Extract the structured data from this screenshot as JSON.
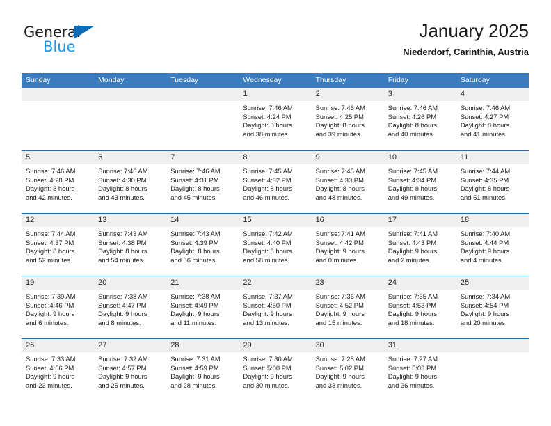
{
  "brand": {
    "name_part1": "General",
    "name_part2": "Blue",
    "triangle_icon": "triangle-icon",
    "accent_color": "#0e6cb5",
    "accent_color_light": "#2196e8"
  },
  "header": {
    "title": "January 2025",
    "subtitle": "Niederdorf, Carinthia, Austria"
  },
  "calendar": {
    "header_bg": "#3a7cbe",
    "row_divider_color": "#2b6cab",
    "date_band_bg": "#efefef",
    "weekdays": [
      "Sunday",
      "Monday",
      "Tuesday",
      "Wednesday",
      "Thursday",
      "Friday",
      "Saturday"
    ],
    "weeks": [
      [
        {
          "day": "",
          "empty": true,
          "lines": []
        },
        {
          "day": "",
          "empty": true,
          "lines": []
        },
        {
          "day": "",
          "empty": true,
          "lines": []
        },
        {
          "day": "1",
          "empty": false,
          "lines": [
            "Sunrise: 7:46 AM",
            "Sunset: 4:24 PM",
            "Daylight: 8 hours",
            "and 38 minutes."
          ]
        },
        {
          "day": "2",
          "empty": false,
          "lines": [
            "Sunrise: 7:46 AM",
            "Sunset: 4:25 PM",
            "Daylight: 8 hours",
            "and 39 minutes."
          ]
        },
        {
          "day": "3",
          "empty": false,
          "lines": [
            "Sunrise: 7:46 AM",
            "Sunset: 4:26 PM",
            "Daylight: 8 hours",
            "and 40 minutes."
          ]
        },
        {
          "day": "4",
          "empty": false,
          "lines": [
            "Sunrise: 7:46 AM",
            "Sunset: 4:27 PM",
            "Daylight: 8 hours",
            "and 41 minutes."
          ]
        }
      ],
      [
        {
          "day": "5",
          "empty": false,
          "lines": [
            "Sunrise: 7:46 AM",
            "Sunset: 4:28 PM",
            "Daylight: 8 hours",
            "and 42 minutes."
          ]
        },
        {
          "day": "6",
          "empty": false,
          "lines": [
            "Sunrise: 7:46 AM",
            "Sunset: 4:30 PM",
            "Daylight: 8 hours",
            "and 43 minutes."
          ]
        },
        {
          "day": "7",
          "empty": false,
          "lines": [
            "Sunrise: 7:46 AM",
            "Sunset: 4:31 PM",
            "Daylight: 8 hours",
            "and 45 minutes."
          ]
        },
        {
          "day": "8",
          "empty": false,
          "lines": [
            "Sunrise: 7:45 AM",
            "Sunset: 4:32 PM",
            "Daylight: 8 hours",
            "and 46 minutes."
          ]
        },
        {
          "day": "9",
          "empty": false,
          "lines": [
            "Sunrise: 7:45 AM",
            "Sunset: 4:33 PM",
            "Daylight: 8 hours",
            "and 48 minutes."
          ]
        },
        {
          "day": "10",
          "empty": false,
          "lines": [
            "Sunrise: 7:45 AM",
            "Sunset: 4:34 PM",
            "Daylight: 8 hours",
            "and 49 minutes."
          ]
        },
        {
          "day": "11",
          "empty": false,
          "lines": [
            "Sunrise: 7:44 AM",
            "Sunset: 4:35 PM",
            "Daylight: 8 hours",
            "and 51 minutes."
          ]
        }
      ],
      [
        {
          "day": "12",
          "empty": false,
          "lines": [
            "Sunrise: 7:44 AM",
            "Sunset: 4:37 PM",
            "Daylight: 8 hours",
            "and 52 minutes."
          ]
        },
        {
          "day": "13",
          "empty": false,
          "lines": [
            "Sunrise: 7:43 AM",
            "Sunset: 4:38 PM",
            "Daylight: 8 hours",
            "and 54 minutes."
          ]
        },
        {
          "day": "14",
          "empty": false,
          "lines": [
            "Sunrise: 7:43 AM",
            "Sunset: 4:39 PM",
            "Daylight: 8 hours",
            "and 56 minutes."
          ]
        },
        {
          "day": "15",
          "empty": false,
          "lines": [
            "Sunrise: 7:42 AM",
            "Sunset: 4:40 PM",
            "Daylight: 8 hours",
            "and 58 minutes."
          ]
        },
        {
          "day": "16",
          "empty": false,
          "lines": [
            "Sunrise: 7:41 AM",
            "Sunset: 4:42 PM",
            "Daylight: 9 hours",
            "and 0 minutes."
          ]
        },
        {
          "day": "17",
          "empty": false,
          "lines": [
            "Sunrise: 7:41 AM",
            "Sunset: 4:43 PM",
            "Daylight: 9 hours",
            "and 2 minutes."
          ]
        },
        {
          "day": "18",
          "empty": false,
          "lines": [
            "Sunrise: 7:40 AM",
            "Sunset: 4:44 PM",
            "Daylight: 9 hours",
            "and 4 minutes."
          ]
        }
      ],
      [
        {
          "day": "19",
          "empty": false,
          "lines": [
            "Sunrise: 7:39 AM",
            "Sunset: 4:46 PM",
            "Daylight: 9 hours",
            "and 6 minutes."
          ]
        },
        {
          "day": "20",
          "empty": false,
          "lines": [
            "Sunrise: 7:38 AM",
            "Sunset: 4:47 PM",
            "Daylight: 9 hours",
            "and 8 minutes."
          ]
        },
        {
          "day": "21",
          "empty": false,
          "lines": [
            "Sunrise: 7:38 AM",
            "Sunset: 4:49 PM",
            "Daylight: 9 hours",
            "and 11 minutes."
          ]
        },
        {
          "day": "22",
          "empty": false,
          "lines": [
            "Sunrise: 7:37 AM",
            "Sunset: 4:50 PM",
            "Daylight: 9 hours",
            "and 13 minutes."
          ]
        },
        {
          "day": "23",
          "empty": false,
          "lines": [
            "Sunrise: 7:36 AM",
            "Sunset: 4:52 PM",
            "Daylight: 9 hours",
            "and 15 minutes."
          ]
        },
        {
          "day": "24",
          "empty": false,
          "lines": [
            "Sunrise: 7:35 AM",
            "Sunset: 4:53 PM",
            "Daylight: 9 hours",
            "and 18 minutes."
          ]
        },
        {
          "day": "25",
          "empty": false,
          "lines": [
            "Sunrise: 7:34 AM",
            "Sunset: 4:54 PM",
            "Daylight: 9 hours",
            "and 20 minutes."
          ]
        }
      ],
      [
        {
          "day": "26",
          "empty": false,
          "lines": [
            "Sunrise: 7:33 AM",
            "Sunset: 4:56 PM",
            "Daylight: 9 hours",
            "and 23 minutes."
          ]
        },
        {
          "day": "27",
          "empty": false,
          "lines": [
            "Sunrise: 7:32 AM",
            "Sunset: 4:57 PM",
            "Daylight: 9 hours",
            "and 25 minutes."
          ]
        },
        {
          "day": "28",
          "empty": false,
          "lines": [
            "Sunrise: 7:31 AM",
            "Sunset: 4:59 PM",
            "Daylight: 9 hours",
            "and 28 minutes."
          ]
        },
        {
          "day": "29",
          "empty": false,
          "lines": [
            "Sunrise: 7:30 AM",
            "Sunset: 5:00 PM",
            "Daylight: 9 hours",
            "and 30 minutes."
          ]
        },
        {
          "day": "30",
          "empty": false,
          "lines": [
            "Sunrise: 7:28 AM",
            "Sunset: 5:02 PM",
            "Daylight: 9 hours",
            "and 33 minutes."
          ]
        },
        {
          "day": "31",
          "empty": false,
          "lines": [
            "Sunrise: 7:27 AM",
            "Sunset: 5:03 PM",
            "Daylight: 9 hours",
            "and 36 minutes."
          ]
        },
        {
          "day": "",
          "empty": true,
          "lines": []
        }
      ]
    ]
  }
}
